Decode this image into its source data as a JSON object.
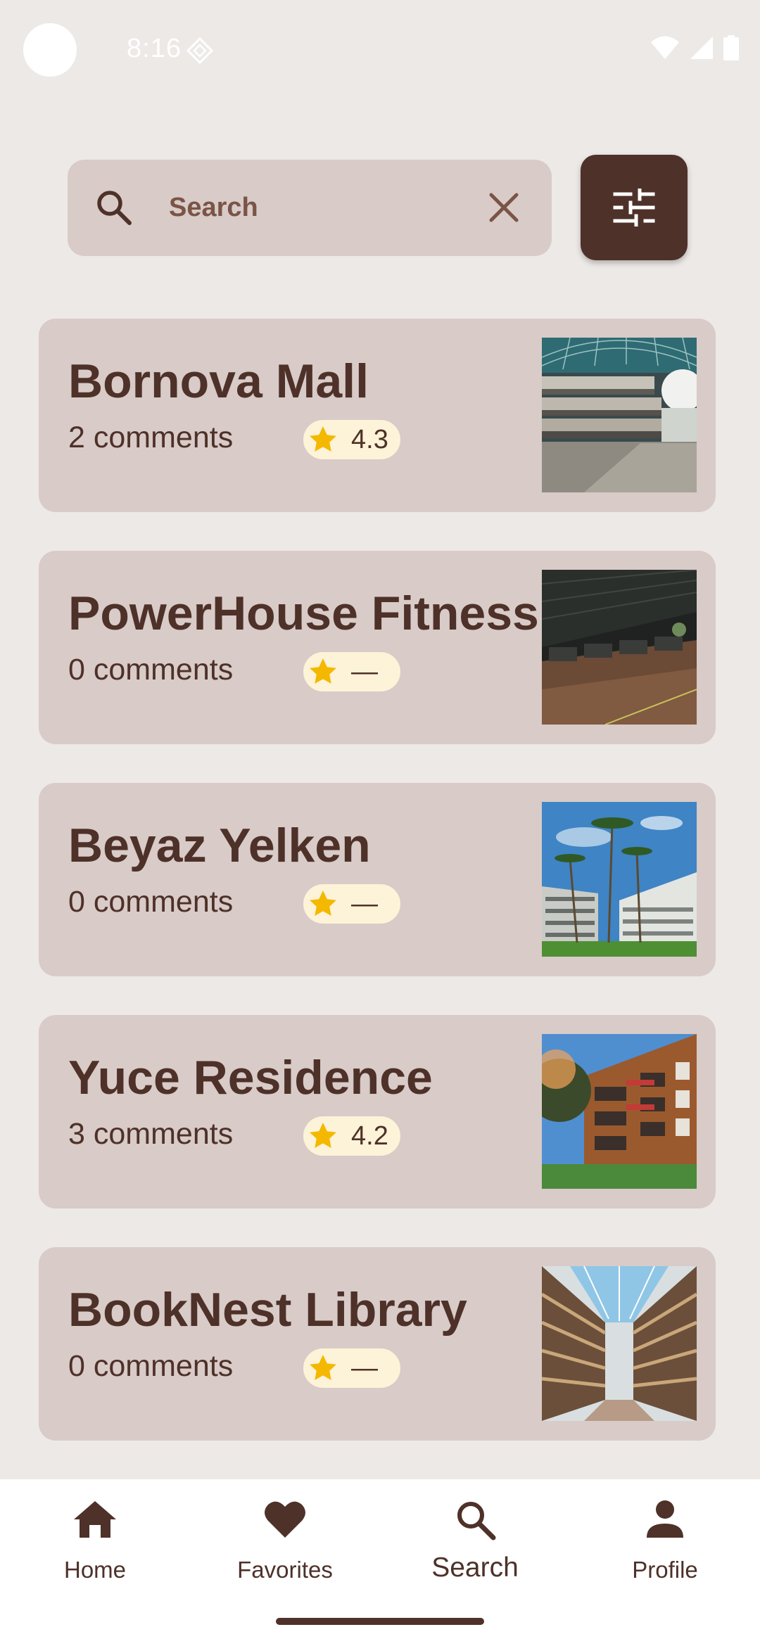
{
  "status_bar": {
    "time": "8:16"
  },
  "search": {
    "placeholder": "Search",
    "value": ""
  },
  "places": [
    {
      "name": "Bornova Mall",
      "comments": "2 comments",
      "rating": "4.3",
      "image": "shopping-mall-interior"
    },
    {
      "name": "PowerHouse Fitness",
      "comments": "0 comments",
      "rating": "—",
      "image": "gym-interior"
    },
    {
      "name": "Beyaz Yelken",
      "comments": "0 comments",
      "rating": "—",
      "image": "hotel-palm-trees"
    },
    {
      "name": "Yuce Residence",
      "comments": "3 comments",
      "rating": "4.2",
      "image": "residence-building"
    },
    {
      "name": "BookNest Library",
      "comments": "0 comments",
      "rating": "—",
      "image": "library-shelves"
    }
  ],
  "nav": [
    {
      "label": "Home",
      "icon": "home-icon",
      "active": false
    },
    {
      "label": "Favorites",
      "icon": "heart-icon",
      "active": false
    },
    {
      "label": "Search",
      "icon": "search-icon",
      "active": true
    },
    {
      "label": "Profile",
      "icon": "person-icon",
      "active": false
    }
  ],
  "colors": {
    "primary": "#4e3129",
    "card": "#d8cbc8",
    "background": "#ede9e7",
    "star": "#f5b800",
    "pill": "#fdf3d8"
  }
}
